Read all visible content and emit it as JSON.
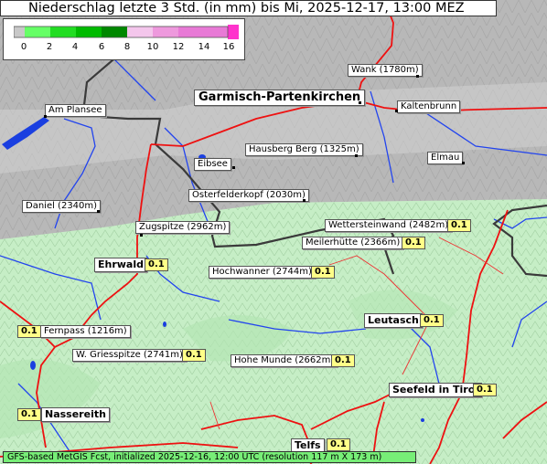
{
  "title": "Niederschlag letzte 3 Std. (in mm) bis Mi, 2025-12-17, 13:00 MEZ",
  "legend": {
    "ticks": [
      "0",
      "2",
      "4",
      "6",
      "8",
      "10",
      "12",
      "14",
      "16"
    ],
    "colors": [
      "#c8c8c8",
      "#66ff66",
      "#22dd22",
      "#00bb00",
      "#008800",
      "#f4c6ec",
      "#ee99dd",
      "#e87ad6",
      "#ff33cc"
    ]
  },
  "places": [
    {
      "id": "wank",
      "name": "Wank (1780m)"
    },
    {
      "id": "garmisch",
      "name": "Garmisch-Partenkirchen"
    },
    {
      "id": "kaltenbrunn",
      "name": "Kaltenbrunn"
    },
    {
      "id": "plansee",
      "name": "Am Plansee"
    },
    {
      "id": "hausberg",
      "name": "Hausberg Berg (1325m)"
    },
    {
      "id": "eibsee",
      "name": "Eibsee"
    },
    {
      "id": "elmau",
      "name": "Elmau"
    },
    {
      "id": "osterfelder",
      "name": "Osterfelderkopf (2030m)"
    },
    {
      "id": "daniel",
      "name": "Daniel (2340m)"
    },
    {
      "id": "zugspitze",
      "name": "Zugspitze (2962m)"
    },
    {
      "id": "wetterstein",
      "name": "Wettersteinwand (2482m)"
    },
    {
      "id": "meiler",
      "name": "Meilerhütte (2366m)"
    },
    {
      "id": "ehrwald",
      "name": "Ehrwald"
    },
    {
      "id": "hochwanner",
      "name": "Hochwanner (2744m)"
    },
    {
      "id": "fernpass",
      "name": "Fernpass (1216m)"
    },
    {
      "id": "leutasch",
      "name": "Leutasch"
    },
    {
      "id": "griesspitze",
      "name": "W. Griesspitze (2741m)"
    },
    {
      "id": "hohemunde",
      "name": "Hohe Munde (2662m)"
    },
    {
      "id": "seefeld",
      "name": "Seefeld in Tirol"
    },
    {
      "id": "nassereith",
      "name": "Nassereith"
    },
    {
      "id": "telfs",
      "name": "Telfs"
    }
  ],
  "values": {
    "wetterstein": "0.1",
    "meiler": "0.1",
    "ehrwald": "0.1",
    "hochwanner": "0.1",
    "fernpass": "0.1",
    "leutasch": "0.1",
    "griesspitze": "0.1",
    "hohemunde": "0.1",
    "seefeld": "0.1",
    "nassereith": "0.1",
    "telfs": "0.1"
  },
  "footer": "GFS-based MetGIS Fcst, initialized 2025-12-16, 12:00 UTC (resolution 117 m X 173 m)"
}
